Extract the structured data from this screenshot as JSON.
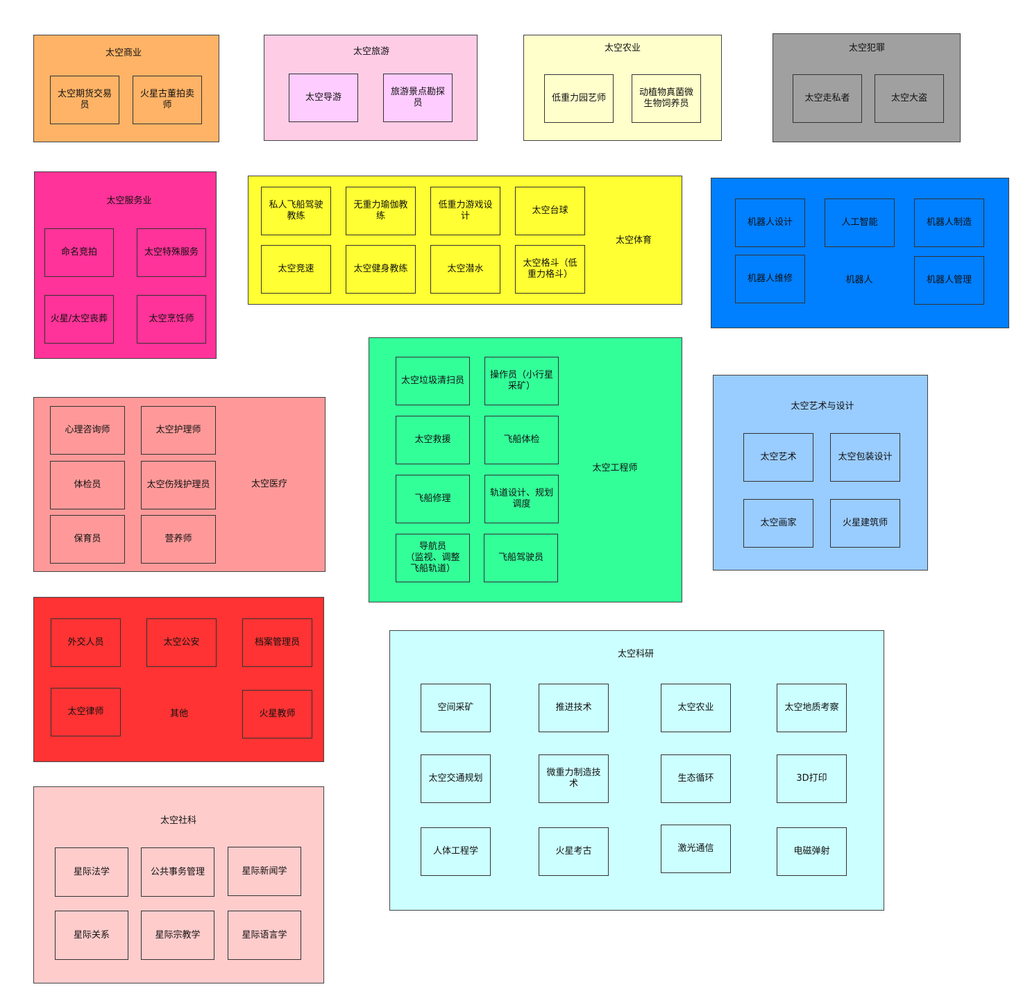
{
  "groups": {
    "commerce": {
      "title": "太空商业",
      "color": "#FFB366",
      "items": [
        "太空期货交易员",
        "火星古董拍卖师"
      ]
    },
    "tourism": {
      "title": "太空旅游",
      "color": "#FFCCE6",
      "item_color": "#FFCCFF",
      "items": [
        "太空导游",
        "旅游景点勘探员"
      ]
    },
    "agriculture": {
      "title": "太空农业",
      "color": "#FFFFCC",
      "items": [
        "低重力园艺师",
        "动植物真菌微生物饲养员"
      ]
    },
    "crime": {
      "title": "太空犯罪",
      "color": "#A0A0A0",
      "items": [
        "太空走私者",
        "太空大盗"
      ]
    },
    "service": {
      "title": "太空服务业",
      "color": "#FF3399",
      "items": [
        "命名竞拍",
        "太空特殊服务",
        "火星/太空丧葬",
        "太空烹饪师"
      ]
    },
    "sports": {
      "title": "太空体育",
      "color": "#FFFF33",
      "items": [
        "私人飞船驾驶教练",
        "无重力瑜伽教练",
        "低重力游戏设计",
        "太空台球",
        "太空竞速",
        "太空健身教练",
        "太空潜水",
        "太空格斗（低重力格斗）"
      ]
    },
    "robot": {
      "title": "机器人",
      "color": "#007FFF",
      "items": [
        "机器人设计",
        "人工智能",
        "机器人制造",
        "机器人维修",
        "机器人管理"
      ]
    },
    "medical": {
      "title": "太空医疗",
      "color": "#FF9999",
      "items": [
        "心理咨询师",
        "太空护理师",
        "体检员",
        "太空伤残护理员",
        "保育员",
        "营养师"
      ]
    },
    "engineer": {
      "title": "太空工程师",
      "color": "#33FF99",
      "items": [
        "太空垃圾清扫员",
        "操作员（小行星采矿）",
        "太空救援",
        "飞船体检",
        "飞船修理",
        "轨道设计、规划\n调度",
        "导航员\n（监视、调整\n飞船轨道）",
        "飞船驾驶员"
      ]
    },
    "art": {
      "title": "太空艺术与设计",
      "color": "#99CCFF",
      "items": [
        "太空艺术",
        "太空包装设计",
        "太空画家",
        "火星建筑师"
      ]
    },
    "other": {
      "title": "其他",
      "color": "#FF3333",
      "items": [
        "外交人员",
        "太空公安",
        "档案管理员",
        "太空律师",
        "火星教师"
      ]
    },
    "research": {
      "title": "太空科研",
      "color": "#CCFFFF",
      "items": [
        "空间采矿",
        "推进技术",
        "太空农业",
        "太空地质考察",
        "太空交通规划",
        "微重力制造技术",
        "生态循环",
        "3D打印",
        "人体工程学",
        "火星考古",
        "激光通信",
        "电磁弹射"
      ]
    },
    "social": {
      "title": "太空社科",
      "color": "#FFCCCC",
      "items": [
        "星际法学",
        "公共事务管理",
        "星际新闻学",
        "星际关系",
        "星际宗教学",
        "星际语言学"
      ]
    }
  }
}
